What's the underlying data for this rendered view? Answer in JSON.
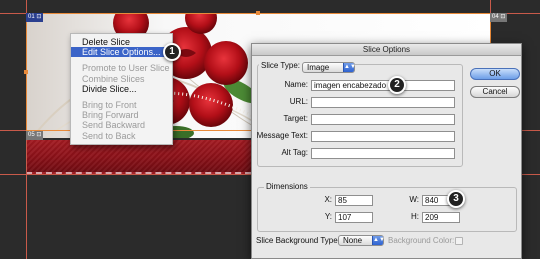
{
  "slice_tags": {
    "top_left": "01",
    "top_left_icon": "⊡",
    "top_right": "04",
    "top_right_icon": "⊡",
    "bottom_left": "05",
    "bottom_left_icon": "⊡"
  },
  "context_menu": {
    "items": [
      {
        "label": "Delete Slice",
        "enabled": true
      },
      {
        "label": "Edit Slice Options...",
        "enabled": true,
        "selected": true
      },
      {
        "label": "Promote to User Slice",
        "enabled": false
      },
      {
        "label": "Combine Slices",
        "enabled": false
      },
      {
        "label": "Divide Slice...",
        "enabled": true
      },
      {
        "label": "Bring to Front",
        "enabled": false
      },
      {
        "label": "Bring Forward",
        "enabled": false
      },
      {
        "label": "Send Backward",
        "enabled": false
      },
      {
        "label": "Send to Back",
        "enabled": false
      }
    ]
  },
  "callouts": [
    "1",
    "2",
    "3"
  ],
  "dialog": {
    "title": "Slice Options",
    "slice_type_label": "Slice Type:",
    "slice_type_value": "Image",
    "name_label": "Name:",
    "name_value": "imagen encabezado",
    "url_label": "URL:",
    "url_value": "",
    "target_label": "Target:",
    "target_value": "",
    "message_label": "Message Text:",
    "message_value": "",
    "alt_label": "Alt Tag:",
    "alt_value": "",
    "dimensions_legend": "Dimensions",
    "x_label": "X:",
    "x_value": "85",
    "y_label": "Y:",
    "y_value": "107",
    "w_label": "W:",
    "w_value": "840",
    "h_label": "H:",
    "h_value": "209",
    "bg_type_label": "Slice Background Type:",
    "bg_type_value": "None",
    "bg_color_label": "Background Color:",
    "ok_label": "OK",
    "cancel_label": "Cancel"
  },
  "colors": {
    "selection_blue": "#3b64c8",
    "slice_border_orange": "#e88a3a",
    "banner_red": "#8b1118",
    "rose_red": "#c0121c"
  }
}
